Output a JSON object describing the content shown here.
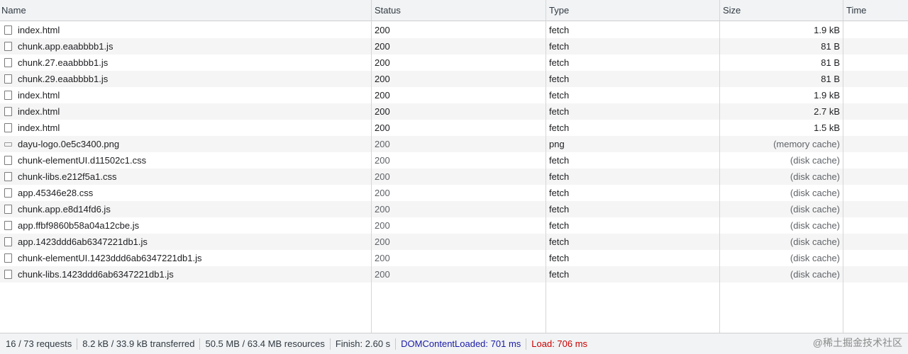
{
  "header": {
    "name": "Name",
    "status": "Status",
    "type": "Type",
    "size": "Size",
    "time": "Time"
  },
  "rows": [
    {
      "name": "index.html",
      "status": "200",
      "type": "fetch",
      "size": "1.9 kB",
      "icon": "document-icon",
      "cached": false
    },
    {
      "name": "chunk.app.eaabbbb1.js",
      "status": "200",
      "type": "fetch",
      "size": "81 B",
      "icon": "document-icon",
      "cached": false
    },
    {
      "name": "chunk.27.eaabbbb1.js",
      "status": "200",
      "type": "fetch",
      "size": "81 B",
      "icon": "document-icon",
      "cached": false
    },
    {
      "name": "chunk.29.eaabbbb1.js",
      "status": "200",
      "type": "fetch",
      "size": "81 B",
      "icon": "document-icon",
      "cached": false
    },
    {
      "name": "index.html",
      "status": "200",
      "type": "fetch",
      "size": "1.9 kB",
      "icon": "document-icon",
      "cached": false
    },
    {
      "name": "index.html",
      "status": "200",
      "type": "fetch",
      "size": "2.7 kB",
      "icon": "document-icon",
      "cached": false
    },
    {
      "name": "index.html",
      "status": "200",
      "type": "fetch",
      "size": "1.5 kB",
      "icon": "document-icon",
      "cached": false
    },
    {
      "name": "dayu-logo.0e5c3400.png",
      "status": "200",
      "type": "png",
      "size": "(memory cache)",
      "icon": "image-icon",
      "cached": true
    },
    {
      "name": "chunk-elementUI.d11502c1.css",
      "status": "200",
      "type": "fetch",
      "size": "(disk cache)",
      "icon": "document-icon",
      "cached": true
    },
    {
      "name": "chunk-libs.e212f5a1.css",
      "status": "200",
      "type": "fetch",
      "size": "(disk cache)",
      "icon": "document-icon",
      "cached": true
    },
    {
      "name": "app.45346e28.css",
      "status": "200",
      "type": "fetch",
      "size": "(disk cache)",
      "icon": "document-icon",
      "cached": true
    },
    {
      "name": "chunk.app.e8d14fd6.js",
      "status": "200",
      "type": "fetch",
      "size": "(disk cache)",
      "icon": "document-icon",
      "cached": true
    },
    {
      "name": "app.ffbf9860b58a04a12cbe.js",
      "status": "200",
      "type": "fetch",
      "size": "(disk cache)",
      "icon": "document-icon",
      "cached": true
    },
    {
      "name": "app.1423ddd6ab6347221db1.js",
      "status": "200",
      "type": "fetch",
      "size": "(disk cache)",
      "icon": "document-icon",
      "cached": true
    },
    {
      "name": "chunk-elementUI.1423ddd6ab6347221db1.js",
      "status": "200",
      "type": "fetch",
      "size": "(disk cache)",
      "icon": "document-icon",
      "cached": true
    },
    {
      "name": "chunk-libs.1423ddd6ab6347221db1.js",
      "status": "200",
      "type": "fetch",
      "size": "(disk cache)",
      "icon": "document-icon",
      "cached": true
    }
  ],
  "status_bar": {
    "requests": "16 / 73 requests",
    "transferred": "8.2 kB / 33.9 kB transferred",
    "resources": "50.5 MB / 63.4 MB resources",
    "finish": "Finish: 2.60 s",
    "dom_content_loaded": "DOMContentLoaded: 701 ms",
    "load": "Load: 706 ms"
  },
  "colors": {
    "dom_content_loaded": "#1a1aa6",
    "load": "#c80000"
  },
  "watermark": "@稀土掘金技术社区"
}
